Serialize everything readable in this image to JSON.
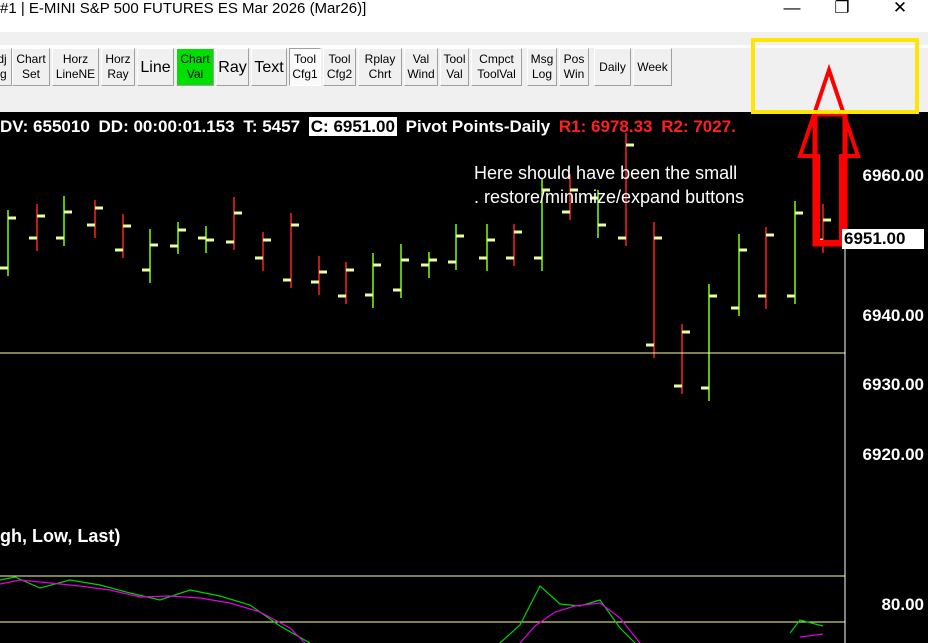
{
  "window": {
    "title": "#1 | E-MINI S&P 500 FUTURES ES Mar 2026 (Mar26)]",
    "buttons": {
      "minimize": "—",
      "restore": "❐",
      "close": "✕"
    }
  },
  "toolbar": {
    "buttons": [
      {
        "label": "dj\nlg"
      },
      {
        "label": "Chart\nSet"
      },
      {
        "label": "Horz\nLineNE"
      },
      {
        "label": "Horz\nRay"
      },
      {
        "label": "Line"
      },
      {
        "label": "Chart\nVal",
        "active": true
      },
      {
        "label": "Ray"
      },
      {
        "label": "Text"
      },
      {
        "label": "Tool\nCfg1",
        "pressed": true
      },
      {
        "label": "Tool\nCfg2"
      },
      {
        "label": "Rplay\nChrt"
      },
      {
        "label": "Val\nWind"
      },
      {
        "label": "Tool\nVal"
      },
      {
        "label": "Cmpct\nToolVal"
      },
      {
        "label": "Msg\nLog"
      },
      {
        "label": "Pos\nWin"
      },
      {
        "label": "Daily"
      },
      {
        "label": "Week"
      }
    ]
  },
  "header": {
    "dv": "DV: 655010",
    "dd": "DD: 00:00:01.153",
    "t": "T: 5457",
    "c": "C: 6951.00",
    "study": "Pivot Points-Daily",
    "r1": "R1: 6978.33",
    "r2": "R2: 7027."
  },
  "annotation": {
    "text": "Here should have been  the small\n. restore/minimize/expand buttons"
  },
  "price_axis": {
    "labels": [
      "6960.00",
      "6951.00",
      "6940.00",
      "6930.00",
      "6920.00",
      "80.00"
    ],
    "current": "6951.00"
  },
  "study_label": "gh, Low, Last)",
  "colors": {
    "up": "#7fff00",
    "down": "#ff2020",
    "close_tick": "#e8ffa0",
    "highlight": "#ffe600",
    "arrow": "#ff0000",
    "pivot_line": "#ffff99",
    "oscillator1": "#00d000",
    "oscillator2": "#e000e0"
  }
}
